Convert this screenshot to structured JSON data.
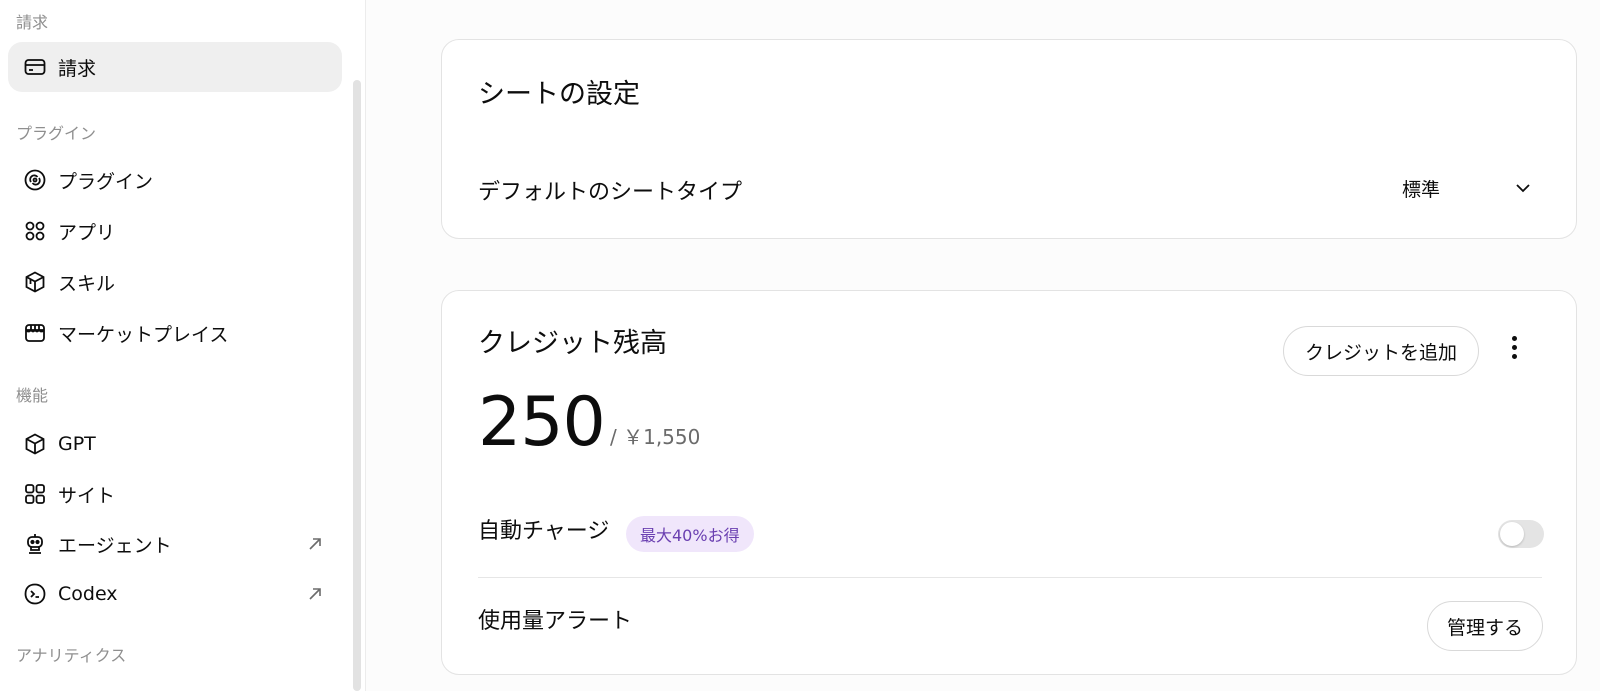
{
  "sidebar": {
    "sections": {
      "billing": "請求",
      "plugins": "プラグイン",
      "features": "機能",
      "analytics": "アナリティクス"
    },
    "items": [
      {
        "label": "請求",
        "icon": "card-icon",
        "active": true
      },
      {
        "label": "プラグイン",
        "icon": "plugin-icon"
      },
      {
        "label": "アプリ",
        "icon": "apps-icon"
      },
      {
        "label": "スキル",
        "icon": "skill-cube-icon"
      },
      {
        "label": "マーケットプレイス",
        "icon": "store-icon"
      },
      {
        "label": "GPT",
        "icon": "gpt-cube-icon"
      },
      {
        "label": "サイト",
        "icon": "site-grid-icon"
      },
      {
        "label": "エージェント",
        "icon": "robot-icon",
        "external": true
      },
      {
        "label": "Codex",
        "icon": "codex-icon",
        "external": true
      }
    ]
  },
  "seat_settings": {
    "title": "シートの設定",
    "default_seat_label": "デフォルトのシートタイプ",
    "default_seat_value": "標準"
  },
  "credits": {
    "title": "クレジット残高",
    "add_button": "クレジットを追加",
    "balance": "250",
    "balance_sub": "/ ￥1,550",
    "auto_charge_label": "自動チャージ",
    "auto_charge_badge": "最大40%お得",
    "auto_charge_on": false,
    "usage_alert_label": "使用量アラート",
    "manage_button": "管理する"
  },
  "colors": {
    "badge_bg": "#f0e6fb",
    "badge_text": "#6a3fb1",
    "active_item_bg": "#efefef"
  }
}
